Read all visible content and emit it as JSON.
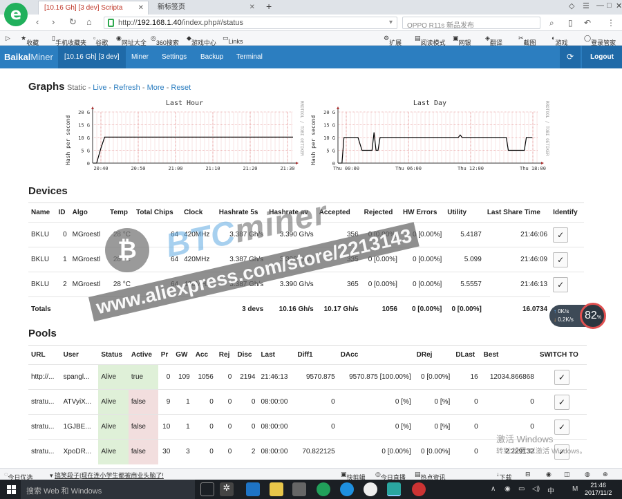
{
  "browser": {
    "active_tab": "[10.16 Gh] [3 dev] Scripta",
    "inactive_tab": "新标签页",
    "url_prefix": "http://",
    "url_host": "192.168.1.40",
    "url_path": "/index.php#/status",
    "search_placeholder": "OPPO R11s 新品发布",
    "bookmarks": [
      "收藏",
      "手机收藏夹",
      "谷歌",
      "网址大全",
      "360搜索",
      "游戏中心",
      "Links"
    ],
    "toolbar_right": [
      "扩展",
      "阅读模式",
      "网银",
      "翻译",
      "截图",
      "游戏",
      "登录管家"
    ]
  },
  "nav": {
    "brand_a": "Baikal",
    "brand_b": "Miner",
    "items": [
      "[10.16 Gh] [3 dev]",
      "Miner",
      "Settings",
      "Backup",
      "Terminal"
    ],
    "logout": "Logout"
  },
  "graphs": {
    "heading": "Graphs",
    "sub_static": "Static",
    "links": [
      "Live",
      "Refresh",
      "More",
      "Reset"
    ],
    "y_label": "Hash per second",
    "right_label": "RRDTOOL / TOBI OETIKER",
    "y_ticks": [
      "20 G",
      "15 G",
      "10 G",
      "5 G",
      "0"
    ],
    "hour": {
      "title": "Last Hour",
      "x_ticks": [
        "20:40",
        "20:50",
        "21:00",
        "21:10",
        "21:20",
        "21:30"
      ]
    },
    "day": {
      "title": "Last Day",
      "x_ticks": [
        "Thu 00:00",
        "Thu 06:00",
        "Thu 12:00",
        "Thu 18:00"
      ]
    }
  },
  "devices": {
    "heading": "Devices",
    "headers": [
      "Name",
      "ID",
      "Algo",
      "Temp",
      "Total Chips",
      "Clock",
      "Hashrate 5s",
      "Hashrate av",
      "Accepted",
      "Rejected",
      "HW Errors",
      "Utility",
      "Last Share Time",
      "Identify"
    ],
    "rows": [
      [
        "BKLU",
        "0",
        "MGroestl",
        "28 °C",
        "64",
        "420MHz",
        "3.387 Gh/s",
        "3.390 Gh/s",
        "356",
        "0 [0.00%]",
        "0 [0.00%]",
        "5.4187",
        "21:46:06"
      ],
      [
        "BKLU",
        "1",
        "MGroestl",
        "28 °C",
        "64",
        "420MHz",
        "3.387 Gh/s",
        "3.390 Gh/s",
        "335",
        "0 [0.00%]",
        "0 [0.00%]",
        "5.099",
        "21:46:09"
      ],
      [
        "BKLU",
        "2",
        "MGroestl",
        "28 °C",
        "64",
        "420MHz",
        "3.387 Gh/s",
        "3.390 Gh/s",
        "365",
        "0 [0.00%]",
        "0 [0.00%]",
        "5.5557",
        "21:46:13"
      ]
    ],
    "totals": [
      "Totals",
      "3 devs",
      "10.16 Gh/s",
      "10.17 Gh/s",
      "1056",
      "0 [0.00%]",
      "0 [0.00%]",
      "16.0734"
    ]
  },
  "pools": {
    "heading": "Pools",
    "headers": [
      "URL",
      "User",
      "Status",
      "Active",
      "Pr",
      "GW",
      "Acc",
      "Rej",
      "Disc",
      "Last",
      "Diff1",
      "DAcc",
      "DRej",
      "DLast",
      "Best",
      "SWITCH TO"
    ],
    "rows": [
      [
        "http://...",
        "spangl...",
        "Alive",
        "true",
        "0",
        "109",
        "1056",
        "0",
        "2194",
        "21:46:13",
        "9570.875",
        "9570.875 [100.00%]",
        "0 [0.00%]",
        "16",
        "12034.866868"
      ],
      [
        "stratu...",
        "ATVyiX...",
        "Alive",
        "false",
        "9",
        "1",
        "0",
        "0",
        "0",
        "08:00:00",
        "0",
        "0 [%]",
        "0 [%]",
        "0",
        "0"
      ],
      [
        "stratu...",
        "1GJBE...",
        "Alive",
        "false",
        "10",
        "1",
        "0",
        "0",
        "0",
        "08:00:00",
        "0",
        "0 [%]",
        "0 [%]",
        "0",
        "0"
      ],
      [
        "stratu...",
        "XpoDR...",
        "Alive",
        "false",
        "30",
        "3",
        "0",
        "0",
        "2",
        "08:00:00",
        "70.822125",
        "0 [0.00%]",
        "0 [0.00%]",
        "0",
        "2.229132"
      ]
    ]
  },
  "watermark": {
    "brand_a": "BTC",
    "brand_b": "miner",
    "url": "www.aliexpress.com/store/2213143"
  },
  "speed_widget": {
    "up": "0K/s",
    "down": "0.2K/s",
    "percent": "82",
    "unit": "%"
  },
  "activation": {
    "line1": "激活 Windows",
    "line2": "转到\"设置\"以激活 Windows。"
  },
  "statusbar": [
    "今日优选",
    "搞笑段子|现在连小学生都被商业头脑了!",
    "快剪辑",
    "今日直播",
    "热点资讯",
    "下载"
  ],
  "taskbar": {
    "search": "搜索 Web 和 Windows",
    "time": "21:46",
    "date": "2017/11/2",
    "lang": "中",
    "ime": "M"
  },
  "colors": {
    "nav_bg": "#2c7ec0",
    "alive": "#dff0d8",
    "inactive": "#f2dede",
    "graph_line": "#000000",
    "graph_grid": "#e07070"
  }
}
